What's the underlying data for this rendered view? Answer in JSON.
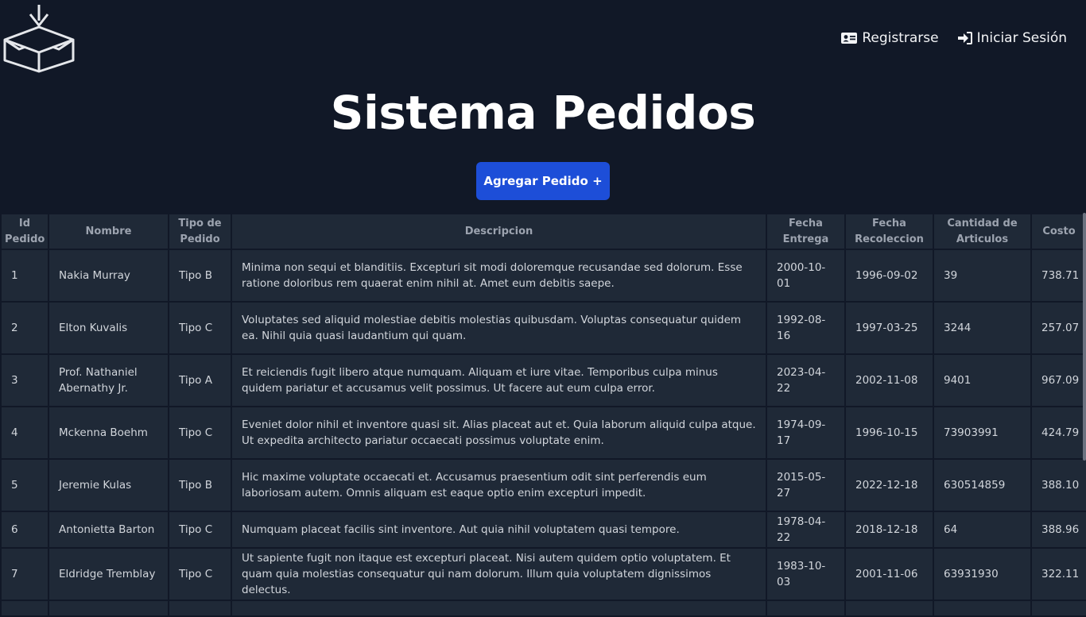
{
  "app": {
    "title": "Sistema Pedidos",
    "logo_icon": "box-download-icon"
  },
  "auth": {
    "register_label": "Registrarse",
    "register_icon": "id-card-icon",
    "login_label": "Iniciar Sesión",
    "login_icon": "sign-in-icon"
  },
  "actions": {
    "add_order_label": "Agregar Pedido +"
  },
  "table": {
    "headers": {
      "id": "Id Pedido",
      "name": "Nombre",
      "type": "Tipo de Pedido",
      "description": "Descripcion",
      "delivery_date": "Fecha Entrega",
      "pickup_date": "Fecha Recoleccion",
      "quantity": "Cantidad de Articulos",
      "cost": "Costo"
    },
    "rows": [
      {
        "id": "1",
        "name": "Nakia Murray",
        "type": "Tipo B",
        "description": "Minima non sequi et blanditiis. Excepturi sit modi doloremque recusandae sed dolorum. Esse ratione doloribus rem quaerat enim nihil at. Amet eum debitis saepe.",
        "delivery_date": "2000-10-01",
        "pickup_date": "1996-09-02",
        "quantity": "39",
        "cost": "738.71"
      },
      {
        "id": "2",
        "name": "Elton Kuvalis",
        "type": "Tipo C",
        "description": "Voluptates sed aliquid molestiae debitis molestias quibusdam. Voluptas consequatur quidem ea. Nihil quia quasi laudantium qui quam.",
        "delivery_date": "1992-08-16",
        "pickup_date": "1997-03-25",
        "quantity": "3244",
        "cost": "257.07"
      },
      {
        "id": "3",
        "name": "Prof. Nathaniel Abernathy Jr.",
        "type": "Tipo A",
        "description": "Et reiciendis fugit libero atque numquam. Aliquam et iure vitae. Temporibus culpa minus quidem pariatur et accusamus velit possimus. Ut facere aut eum culpa error.",
        "delivery_date": "2023-04-22",
        "pickup_date": "2002-11-08",
        "quantity": "9401",
        "cost": "967.09"
      },
      {
        "id": "4",
        "name": "Mckenna Boehm",
        "type": "Tipo C",
        "description": "Eveniet dolor nihil et inventore quasi sit. Alias placeat aut et. Quia laborum aliquid culpa atque. Ut expedita architecto pariatur occaecati possimus voluptate enim.",
        "delivery_date": "1974-09-17",
        "pickup_date": "1996-10-15",
        "quantity": "73903991",
        "cost": "424.79"
      },
      {
        "id": "5",
        "name": "Jeremie Kulas",
        "type": "Tipo B",
        "description": "Hic maxime voluptate occaecati et. Accusamus praesentium odit sint perferendis eum laboriosam autem. Omnis aliquam est eaque optio enim excepturi impedit.",
        "delivery_date": "2015-05-27",
        "pickup_date": "2022-12-18",
        "quantity": "630514859",
        "cost": "388.10"
      },
      {
        "id": "6",
        "name": "Antonietta Barton",
        "type": "Tipo C",
        "description": "Numquam placeat facilis sint inventore. Aut quia nihil voluptatem quasi tempore.",
        "delivery_date": "1978-04-22",
        "pickup_date": "2018-12-18",
        "quantity": "64",
        "cost": "388.96"
      },
      {
        "id": "7",
        "name": "Eldridge Tremblay",
        "type": "Tipo C",
        "description": "Ut sapiente fugit non itaque est excepturi placeat. Nisi autem quidem optio voluptatem. Et quam quia molestias consequatur qui nam dolorum. Illum quia voluptatem dignissimos delectus.",
        "delivery_date": "1983-10-03",
        "pickup_date": "2001-11-06",
        "quantity": "63931930",
        "cost": "322.11"
      }
    ]
  }
}
